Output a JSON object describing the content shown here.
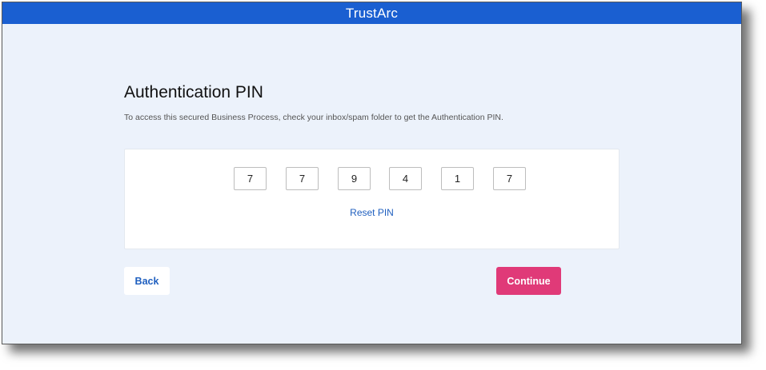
{
  "header": {
    "brand": "TrustArc",
    "accent_color": "#1a5fd1"
  },
  "main": {
    "title": "Authentication PIN",
    "description": "To access this secured Business Process, check your inbox/spam folder to get the Authentication PIN.",
    "pin_digits": [
      "7",
      "7",
      "9",
      "4",
      "1",
      "7"
    ],
    "reset_label": "Reset PIN"
  },
  "actions": {
    "back_label": "Back",
    "continue_label": "Continue",
    "continue_color": "#e03a78"
  }
}
